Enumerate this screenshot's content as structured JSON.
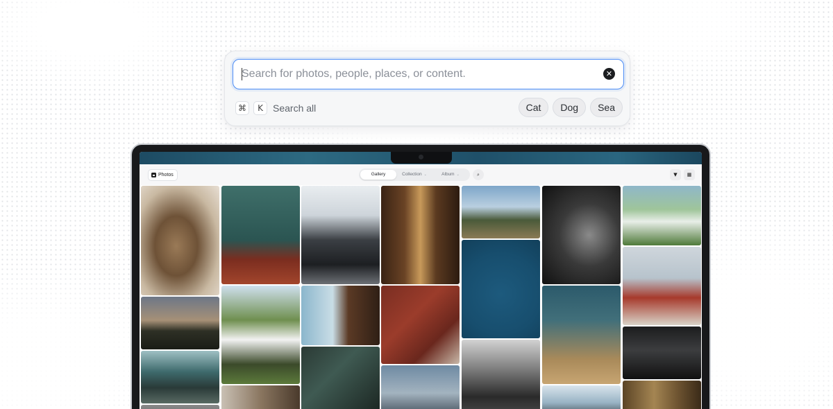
{
  "search": {
    "placeholder": "Search for photos, people, places, or content.",
    "clear_symbol": "✕",
    "shortcut_keys": [
      "⌘",
      "K"
    ],
    "search_all_label": "Search all",
    "suggestions": [
      "Cat",
      "Dog",
      "Sea"
    ]
  },
  "app": {
    "name": "Photos",
    "tabs": [
      {
        "label": "Gallery",
        "active": true
      },
      {
        "label": "Collection",
        "active": false,
        "has_dropdown": true
      },
      {
        "label": "Album",
        "active": false,
        "has_dropdown": true
      }
    ],
    "icons": [
      "search-icon",
      "filter-icon",
      "grid-icon"
    ]
  },
  "colors": {
    "focus_ring": "#4a8bf5",
    "card_bg": "#f6f7f8",
    "chip_bg": "#ececee"
  },
  "gallery": {
    "photos": [
      {
        "id": "cat",
        "bg": "radial-gradient(ellipse at 45% 55%, #9a7a57 0%, #6e5237 35%, #c9b9a2 70%, #e8dfd4 100%)"
      },
      {
        "id": "teal-room",
        "bg": "linear-gradient(180deg, #3f6f6a 0%, #2b5552 55%, #7b2d1f 75%, #a2452c 100%)"
      },
      {
        "id": "car-marina",
        "bg": "linear-gradient(180deg, #e9edf0 0%, #cdd4da 30%, #3b3f44 55%, #1d1f22 80%, #6c7075 100%)"
      },
      {
        "id": "library",
        "bg": "linear-gradient(90deg, #3a2314 0%, #6a4325 30%, #c89a5a 50%, #5b3a20 70%, #2c1b10 100%)"
      },
      {
        "id": "house-trees",
        "bg": "linear-gradient(180deg, #7ea6c9 0%, #b9cfe0 40%, #4a5a3a 65%, #8a7a55 100%)"
      },
      {
        "id": "bw-man",
        "bg": "radial-gradient(ellipse at 60% 50%, #8a8a8a 0%, #3a3a3a 45%, #111 100%)"
      },
      {
        "id": "golf-cart",
        "bg": "linear-gradient(180deg, #8fb7c9 0%, #9fc59a 40%, #e8eee8 60%, #4f7a3a 100%)"
      },
      {
        "id": "sunset-field",
        "bg": "linear-gradient(180deg, #6d7787 0%, #a69077 45%, #2e3025 65%, #1a1c16 100%)"
      },
      {
        "id": "white-house",
        "bg": "linear-gradient(180deg, #cfe0ee 0%, #6f8f4f 35%, #f2f2f2 55%, #3b4a2a 80%, #5c7a3b 100%)"
      },
      {
        "id": "beach-window",
        "bg": "linear-gradient(90deg, #8bb6cc 0%, #c9dde6 40%, #5b3a25 60%, #2f1f15 100%)"
      },
      {
        "id": "airplane-moon",
        "bg": "radial-gradient(circle at 50% 55%, #1d5a7d 0%, #174e6e 60%, #12405b 100%)"
      },
      {
        "id": "ocean-shadow",
        "bg": "linear-gradient(180deg, #2c5a6b 0%, #416f7a 35%, #a98a5a 75%, #c7a572 100%)"
      },
      {
        "id": "lifeguard",
        "bg": "linear-gradient(180deg, #cfd6dc 0%, #b7c3cc 40%, #a73a2c 65%, #d8d3c8 100%)"
      },
      {
        "id": "machinery",
        "bg": "linear-gradient(180deg, #9fc0c4 0%, #3e6a6c 40%, #2a3a38 70%, #586a63 100%)"
      },
      {
        "id": "dark-building",
        "bg": "linear-gradient(135deg, #2b3a35 0%, #3f5a52 40%, #1a2420 100%)"
      },
      {
        "id": "brick-building",
        "bg": "linear-gradient(135deg, #7a2e22 0%, #9b3c2b 40%, #6a271d 70%, #c8b8a8 100%)"
      },
      {
        "id": "cockpit",
        "bg": "linear-gradient(180deg, #d2d2d2 0%, #7a7a7a 40%, #2a2a2a 75%, #4a4a4a 100%)"
      },
      {
        "id": "silhouettes",
        "bg": "linear-gradient(180deg, #1c1d1e 0%, #3c3d3f 45%, #111 100%)"
      },
      {
        "id": "guitar-room",
        "bg": "linear-gradient(90deg, #c9c0b4 0%, #8a7660 50%, #4a3a2c 100%)"
      },
      {
        "id": "dusk-city",
        "bg": "linear-gradient(180deg, #6e8aa3 0%, #a3b3bf 50%, #2e3a45 100%)"
      },
      {
        "id": "window-view",
        "bg": "linear-gradient(180deg, #d9e4ec 0%, #98b3c4 50%, #2a2f33 100%)"
      },
      {
        "id": "curtain-room",
        "bg": "linear-gradient(90deg, #5b4426 0%, #a48552 40%, #6e5431 70%, #3a2a18 100%)"
      },
      {
        "id": "extra-bottom",
        "bg": "linear-gradient(180deg, #8a8a8a 0%, #5a5a5a 100%)"
      }
    ]
  }
}
